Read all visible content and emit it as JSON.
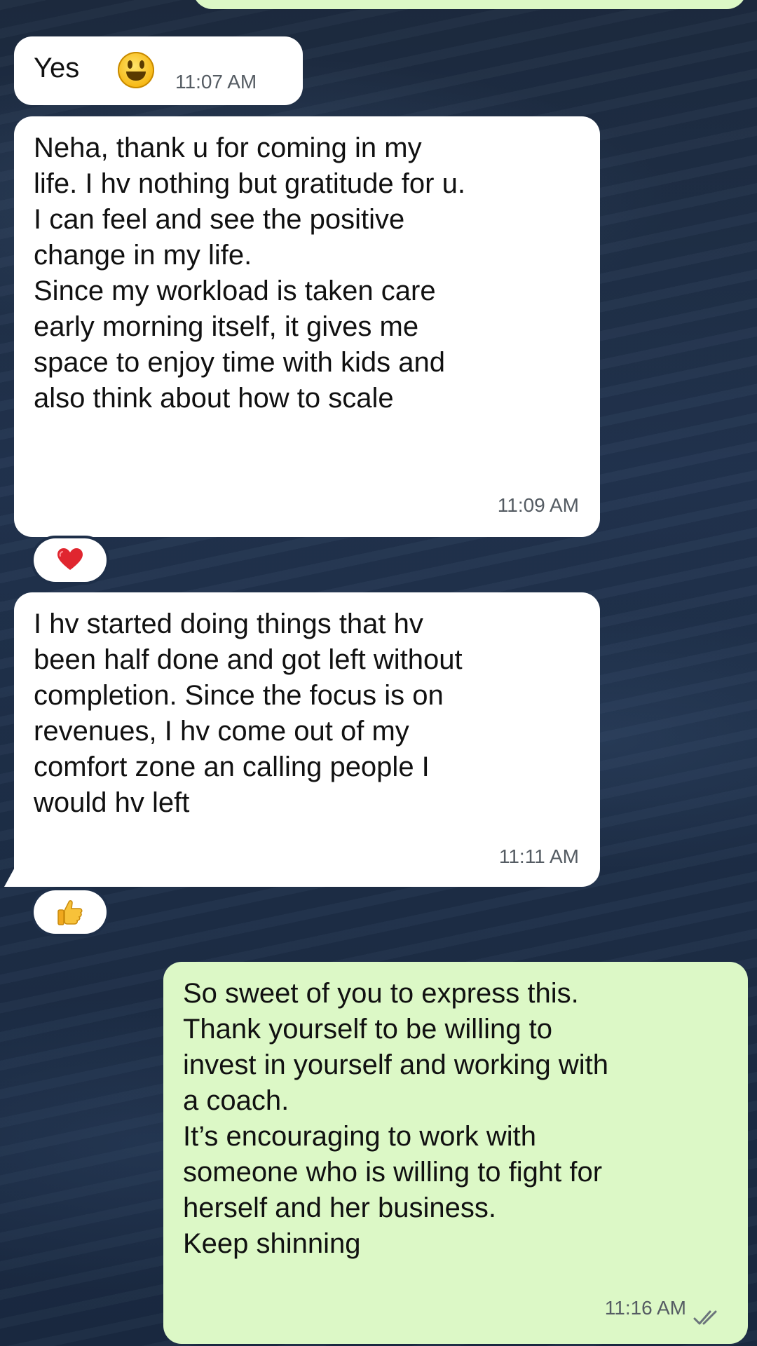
{
  "conversation": {
    "messages": [
      {
        "direction": "incoming",
        "text": "Yes",
        "emoji_icon": "grinning-face-emoji",
        "time": "11:07 AM"
      },
      {
        "direction": "incoming",
        "text": "Neha, thank u for coming in my\nlife. I hv nothing but gratitude for u.\nI can feel and see the positive\nchange in my life.\nSince my workload is taken care\nearly morning itself, it gives me\nspace to enjoy time with kids and\nalso think about how to scale",
        "time": "11:09 AM",
        "reaction_icon": "red-heart-emoji"
      },
      {
        "direction": "incoming",
        "text": "I hv started doing things that hv\nbeen half done and got left without\ncompletion. Since the focus is on\nrevenues, I hv come out of my\ncomfort zone an calling people I\nwould hv left",
        "time": "11:11 AM",
        "reaction_icon": "thumbs-up-emoji"
      },
      {
        "direction": "outgoing",
        "text": "So sweet of you to express this.\nThank yourself to be willing to\ninvest in yourself and working with\na coach.\nIt’s encouraging to work with\nsomeone who is willing to fight for\nherself and her business.\nKeep shinning",
        "time": "11:16 AM",
        "status_icon": "double-check-read-icon"
      }
    ]
  },
  "colors": {
    "incoming_bubble": "#ffffff",
    "outgoing_bubble": "#dcf8c6",
    "background": "#1e2f49",
    "heart": "#e0262f"
  }
}
